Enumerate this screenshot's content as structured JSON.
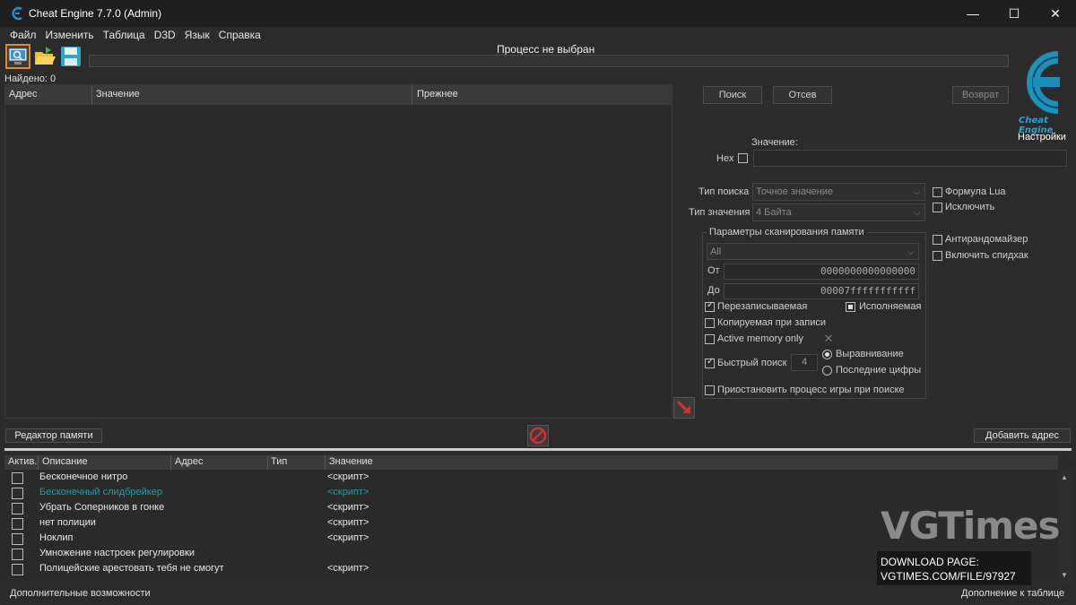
{
  "window": {
    "title": "Cheat Engine 7.7.0 (Admin)"
  },
  "menu": [
    "Файл",
    "Изменить",
    "Таблица",
    "D3D",
    "Язык",
    "Справка"
  ],
  "toolbar": {
    "icons": [
      "open-process-icon",
      "open-file-icon",
      "save-icon"
    ]
  },
  "process_label": "Процесс не выбран",
  "found_label": "Найдено: 0",
  "found_list": {
    "columns": [
      "Адрес",
      "Значение",
      "Прежнее"
    ]
  },
  "scan": {
    "first_scan": "Поиск",
    "next_scan": "Отсев",
    "undo_scan": "Возврат",
    "settings": "Настройки",
    "value_label": "Значение:",
    "hex_label": "Hex",
    "scan_type_label": "Тип поиска",
    "scan_type_value": "Точное значение",
    "value_type_label": "Тип значения",
    "value_type_value": "4 Байта",
    "lua_formula": "Формула Lua",
    "not_label": "Исключить",
    "unrandomizer": "Антирандомайзер",
    "speedhack": "Включить спидхак",
    "mem_group_title": "Параметры сканирования памяти",
    "region_value": "All",
    "from_label": "От",
    "from_value": "0000000000000000",
    "to_label": "До",
    "to_value": "00007fffffffffff",
    "writable": "Перезаписываемая",
    "executable": "Исполняемая",
    "copy_on_write": "Копируемая при записи",
    "active_memory_only": "Active memory only",
    "fast_scan": "Быстрый поиск",
    "fast_scan_value": "4",
    "alignment": "Выравнивание",
    "last_digits": "Последние цифры",
    "pause_process": "Приостановить процесс игры при поиске"
  },
  "memory_view_btn": "Редактор памяти",
  "add_address_btn": "Добавить адрес",
  "table": {
    "columns": [
      "Актив.",
      "Описание",
      "Адрес",
      "Тип",
      "Значение"
    ],
    "rows": [
      {
        "desc": "Бесконечное нитро",
        "value": "<скрипт>",
        "color": "#e8e8e8"
      },
      {
        "desc": "Бесконечный слидбрейкер",
        "value": "<скрипт>",
        "color": "#2a9aa0"
      },
      {
        "desc": "Убрать Соперников в гонке",
        "value": "<скрипт>",
        "color": "#e8e8e8"
      },
      {
        "desc": "нет полиции",
        "value": "<скрипт>",
        "color": "#e8e8e8"
      },
      {
        "desc": "Ноклип",
        "value": "<скрипт>",
        "color": "#e8e8e8"
      },
      {
        "desc": "Умножение настроек регулировки",
        "value": "",
        "color": "#e8e8e8"
      },
      {
        "desc": "Полицейские арестовать тебя не смогут",
        "value": "<скрипт>",
        "color": "#e8e8e8"
      }
    ]
  },
  "footer": {
    "left": "Дополнительные возможности",
    "right": "Дополнение к таблице"
  },
  "watermark": {
    "title": "VGTimes",
    "line1": "DOWNLOAD PAGE:",
    "line2": "VGTIMES.COM/FILE/97927"
  }
}
